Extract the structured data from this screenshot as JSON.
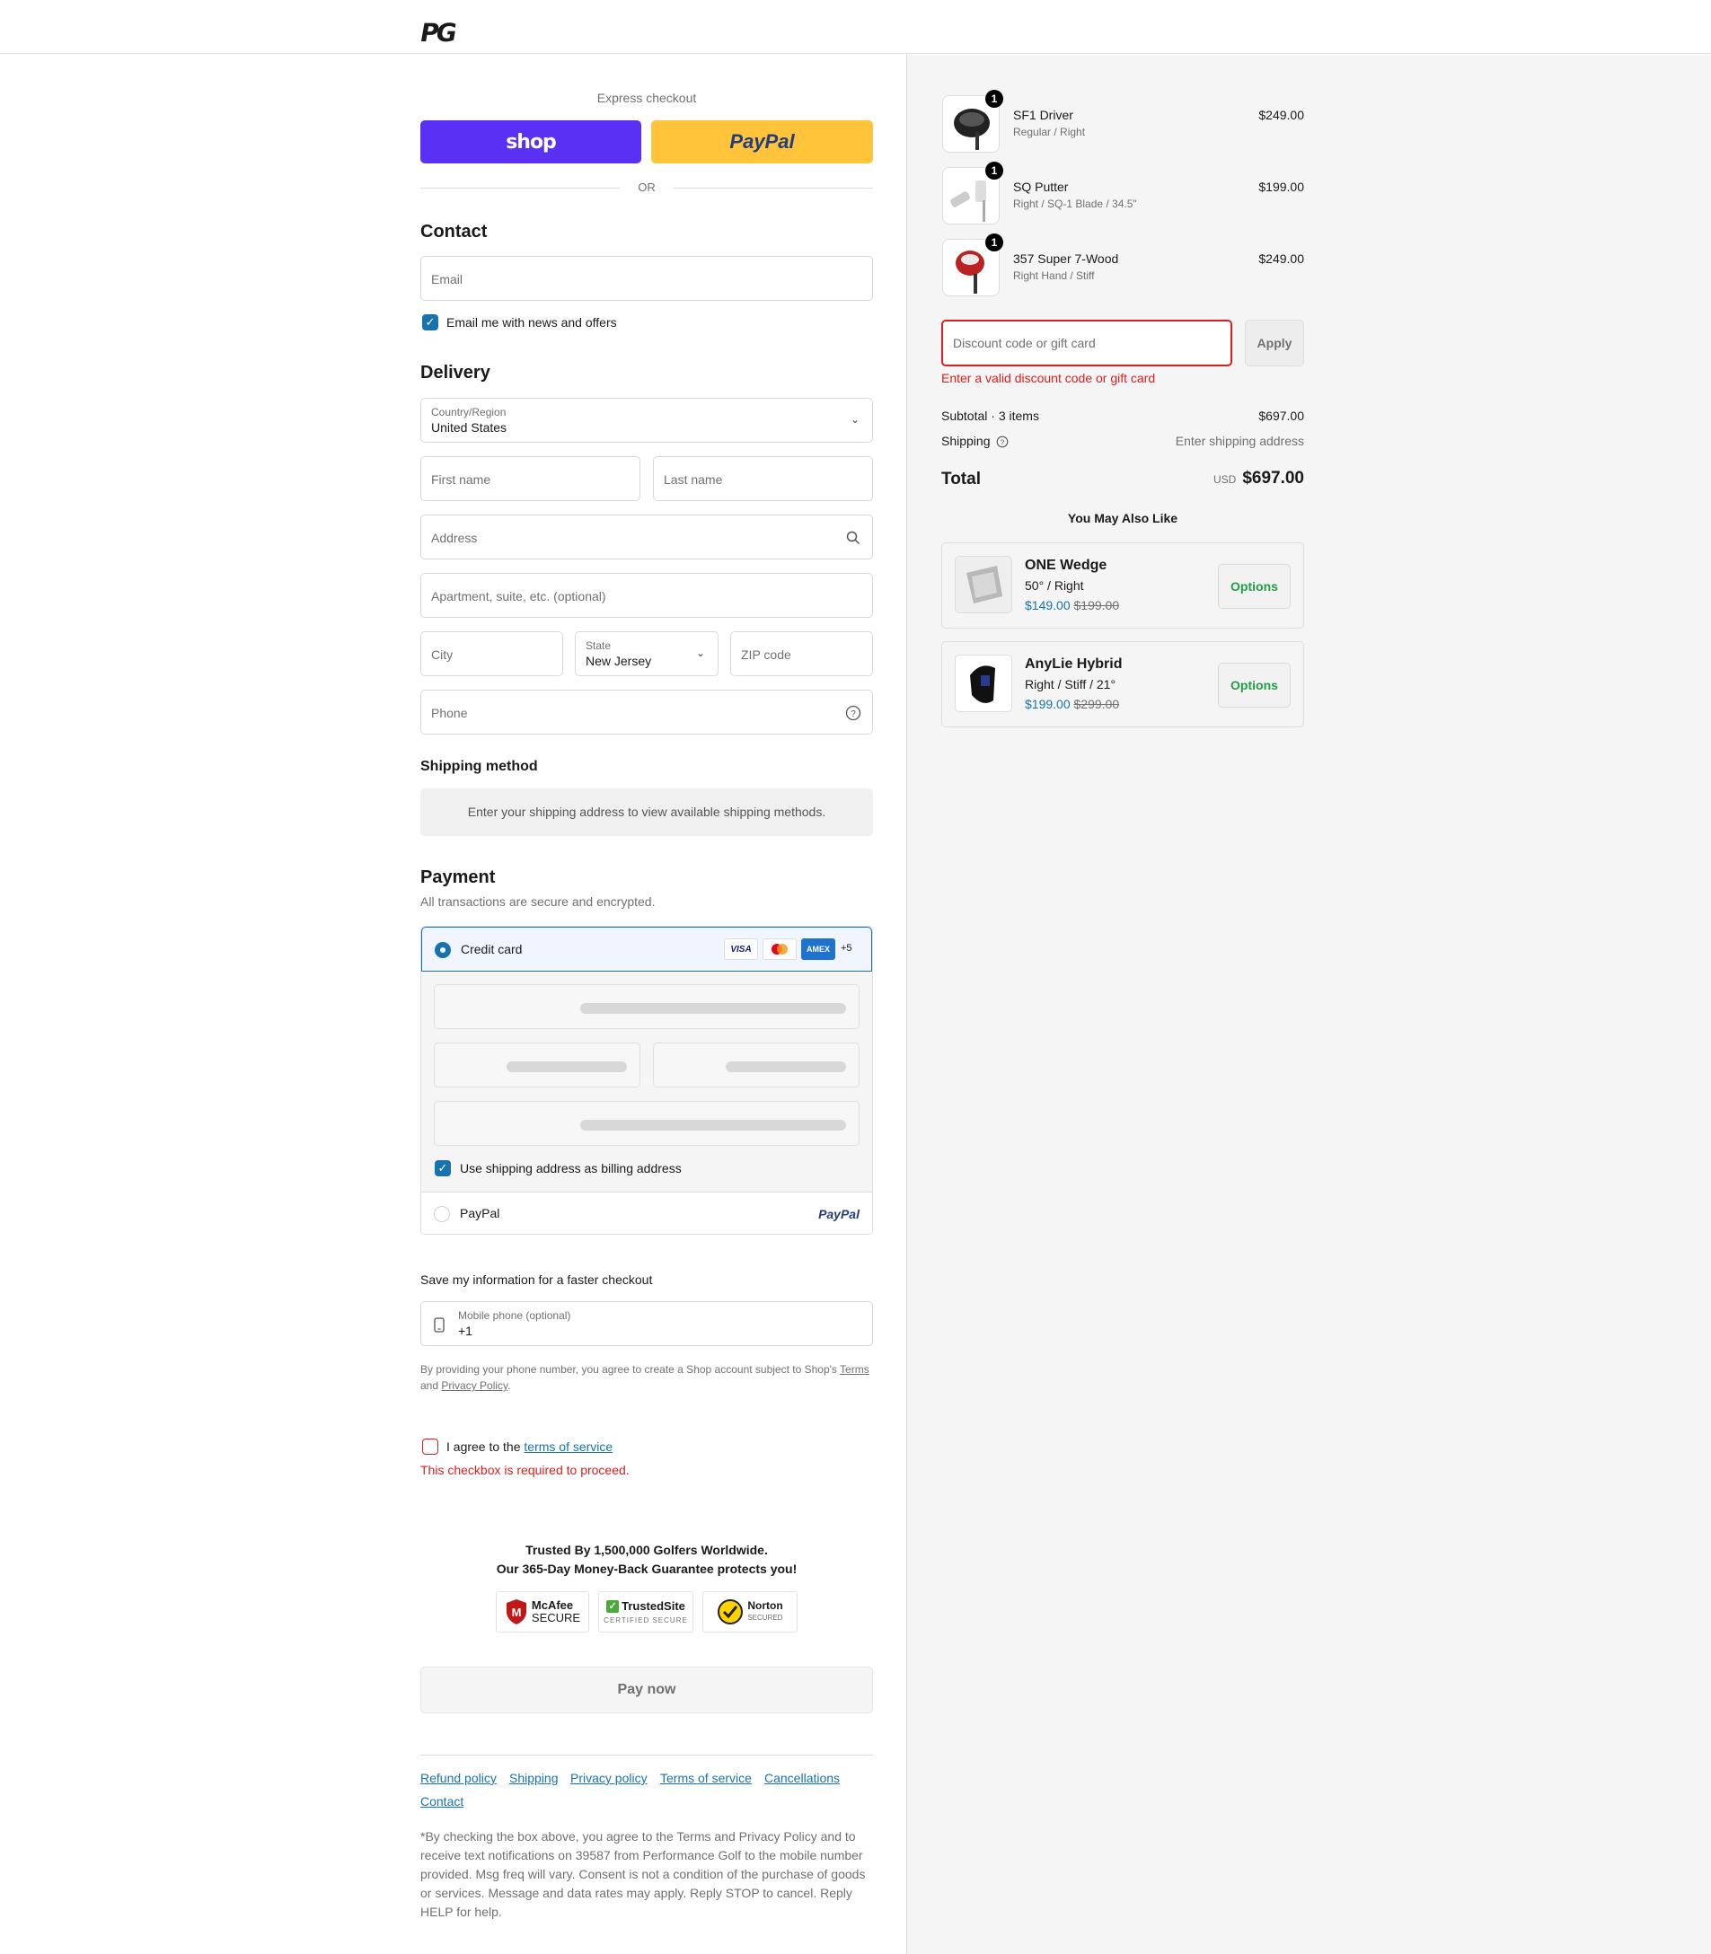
{
  "header": {
    "logo_text": "PG"
  },
  "express": {
    "title": "Express checkout",
    "shop_label": "shop",
    "paypal_label": "PayPal",
    "or_label": "OR",
    "shop_color": "#5a31f4",
    "paypal_color": "#ffc439"
  },
  "contact": {
    "heading": "Contact",
    "email_placeholder": "Email",
    "newsletter_label": "Email me with news and offers",
    "newsletter_checked": true
  },
  "delivery": {
    "heading": "Delivery",
    "country_label": "Country/Region",
    "country_value": "United States",
    "first_name_placeholder": "First name",
    "last_name_placeholder": "Last name",
    "address_placeholder": "Address",
    "apartment_placeholder": "Apartment, suite, etc. (optional)",
    "city_placeholder": "City",
    "state_label": "State",
    "state_value": "New Jersey",
    "zip_placeholder": "ZIP code",
    "phone_placeholder": "Phone"
  },
  "shipping_method": {
    "heading": "Shipping method",
    "message": "Enter your shipping address to view available shipping methods."
  },
  "payment": {
    "heading": "Payment",
    "subtitle": "All transactions are secure and encrypted.",
    "credit_card_label": "Credit card",
    "card_logos": [
      "VISA",
      "",
      "AMEX",
      "+5"
    ],
    "billing_label": "Use shipping address as billing address",
    "paypal_label": "PayPal",
    "paypal_logo": "PayPal"
  },
  "save_info": {
    "heading": "Save my information for a faster checkout",
    "phone_label": "Mobile phone (optional)",
    "phone_value": "+1",
    "legal_prefix": "By providing your phone number, you agree to create a Shop account subject to Shop's",
    "terms_link": "Terms",
    "and": "and",
    "privacy_link": "Privacy Policy",
    "period": "."
  },
  "terms": {
    "agree_prefix": "I agree to the",
    "terms_link": "terms of service",
    "error": "This checkbox is required to proceed."
  },
  "trust": {
    "line1": "Trusted By 1,500,000 Golfers Worldwide.",
    "line2": "Our 365-Day Money-Back Guarantee protects you!",
    "badges": [
      {
        "main": "McAfee",
        "sub": "SECURE"
      },
      {
        "main": "TrustedSite",
        "sub": "CERTIFIED SECURE"
      },
      {
        "main": "Norton",
        "sub": "SECURED"
      }
    ]
  },
  "pay_now": "Pay now",
  "footer": {
    "links": [
      "Refund policy",
      "Shipping",
      "Privacy policy",
      "Terms of service",
      "Cancellations",
      "Contact"
    ],
    "disclaimer": "*By checking the box above, you agree to the Terms and Privacy Policy and to receive text notifications on 39587 from Performance Golf to the mobile number provided. Msg freq will vary. Consent is not a condition of the purchase of goods or services. Message and data rates may apply. Reply STOP to cancel. Reply HELP for help."
  },
  "summary": {
    "items": [
      {
        "name": "SF1 Driver",
        "variant": "Regular / Right",
        "price": "$249.00",
        "qty": "1"
      },
      {
        "name": "SQ Putter",
        "variant": "Right / SQ-1 Blade / 34.5\"",
        "price": "$199.00",
        "qty": "1"
      },
      {
        "name": "357 Super 7-Wood",
        "variant": "Right Hand / Stiff",
        "price": "$249.00",
        "qty": "1"
      }
    ],
    "discount_placeholder": "Discount code or gift card",
    "apply_label": "Apply",
    "discount_error": "Enter a valid discount code or gift card",
    "subtotal_label": "Subtotal · 3 items",
    "subtotal_value": "$697.00",
    "shipping_label": "Shipping",
    "shipping_value": "Enter shipping address",
    "total_label": "Total",
    "currency": "USD",
    "total_value": "$697.00",
    "upsell_heading": "You May Also Like",
    "upsells": [
      {
        "name": "ONE Wedge",
        "variant": "50° / Right",
        "price": "$149.00",
        "compare": "$199.00",
        "button": "Options"
      },
      {
        "name": "AnyLie Hybrid",
        "variant": "Right / Stiff / 21°",
        "price": "$199.00",
        "compare": "$299.00",
        "button": "Options"
      }
    ]
  }
}
